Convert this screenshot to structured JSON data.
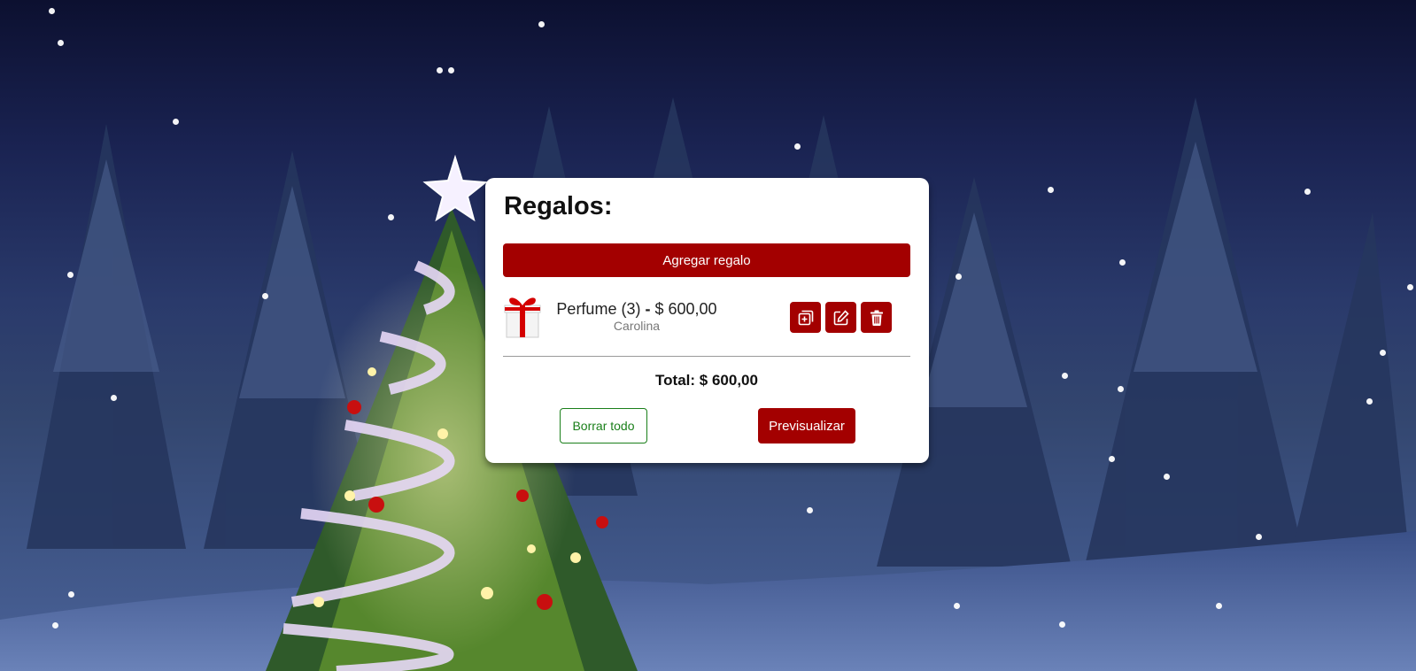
{
  "gifts_panel": {
    "title": "Regalos:",
    "add_button": "Agregar regalo",
    "items": [
      {
        "name": "Perfume",
        "quantity": "(3)",
        "separator": "-",
        "price": "$ 600,00",
        "recipient": "Carolina",
        "actions": [
          "duplicate-icon",
          "edit-icon",
          "trash-icon"
        ]
      }
    ],
    "total_label": "Total: $ 600,00",
    "clear_button": "Borrar todo",
    "preview_button": "Previsualizar"
  },
  "colors": {
    "primary": "#a30000",
    "secondary_outline": "#1a7f1a",
    "card_background": "#ffffff",
    "night_sky": "#0c1030"
  }
}
